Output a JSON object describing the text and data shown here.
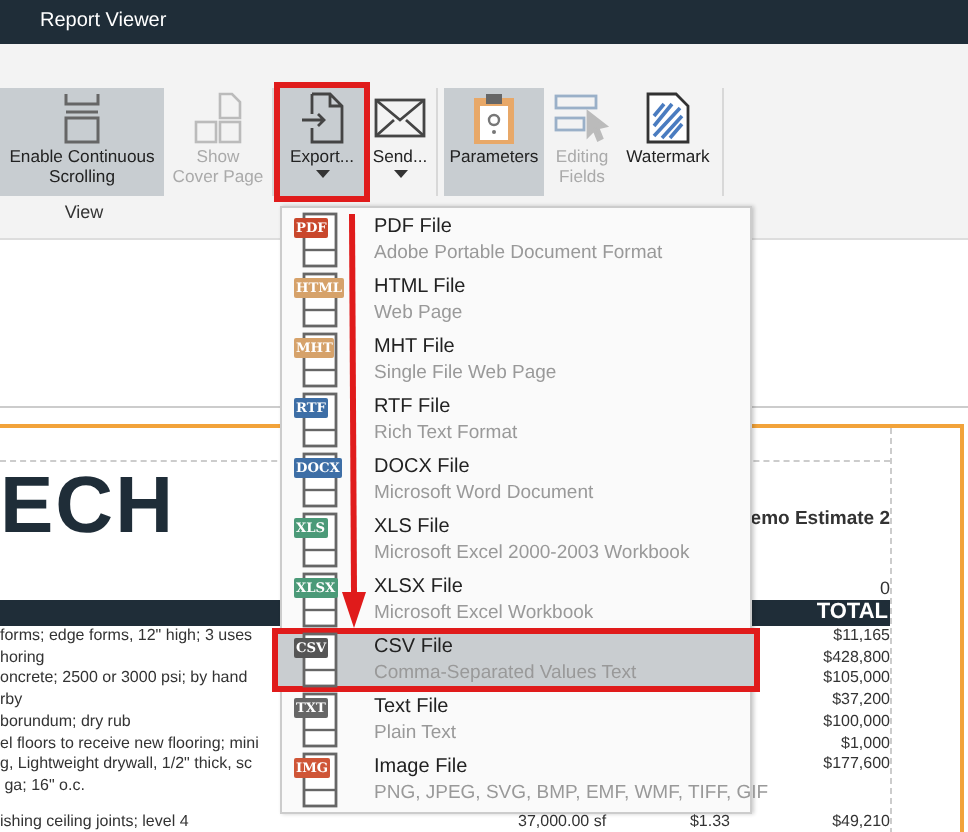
{
  "window": {
    "title": "Report Viewer"
  },
  "ribbon": {
    "buttons": [
      {
        "label": "Enable Continuous Scrolling",
        "selected": true,
        "disabled": false,
        "dropdown": false,
        "outlined": false
      },
      {
        "label": "Show Cover Page",
        "selected": false,
        "disabled": true,
        "dropdown": false,
        "outlined": false
      },
      {
        "label": "Export...",
        "selected": true,
        "disabled": false,
        "dropdown": true,
        "outlined": true
      },
      {
        "label": "Send...",
        "selected": false,
        "disabled": false,
        "dropdown": true,
        "outlined": false
      },
      {
        "label": "Parameters",
        "selected": true,
        "disabled": false,
        "dropdown": false,
        "outlined": false
      },
      {
        "label": "Editing Fields",
        "selected": false,
        "disabled": true,
        "dropdown": false,
        "outlined": false
      },
      {
        "label": "Watermark",
        "selected": false,
        "disabled": false,
        "dropdown": false,
        "outlined": false
      }
    ],
    "group_label": "View"
  },
  "export_menu": {
    "items": [
      {
        "badge": "PDF",
        "color": "#c9472c",
        "title": "PDF File",
        "description": "Adobe Portable Document Format",
        "selected": false,
        "outlined": false
      },
      {
        "badge": "HTML",
        "color": "#d6a26a",
        "title": "HTML File",
        "description": "Web Page",
        "selected": false,
        "outlined": false
      },
      {
        "badge": "MHT",
        "color": "#d6a26a",
        "title": "MHT File",
        "description": "Single File Web Page",
        "selected": false,
        "outlined": false
      },
      {
        "badge": "RTF",
        "color": "#3d6ea6",
        "title": "RTF File",
        "description": "Rich Text Format",
        "selected": false,
        "outlined": false
      },
      {
        "badge": "DOCX",
        "color": "#3d6ea6",
        "title": "DOCX File",
        "description": "Microsoft Word Document",
        "selected": false,
        "outlined": false
      },
      {
        "badge": "XLS",
        "color": "#4b9a78",
        "title": "XLS File",
        "description": "Microsoft Excel 2000-2003 Workbook",
        "selected": false,
        "outlined": false
      },
      {
        "badge": "XLSX",
        "color": "#4b9a78",
        "title": "XLSX File",
        "description": "Microsoft Excel Workbook",
        "selected": false,
        "outlined": false
      },
      {
        "badge": "CSV",
        "color": "#555555",
        "title": "CSV File",
        "description": "Comma-Separated Values Text",
        "selected": true,
        "outlined": true
      },
      {
        "badge": "TXT",
        "color": "#666666",
        "title": "Text File",
        "description": "Plain Text",
        "selected": false,
        "outlined": false
      },
      {
        "badge": "IMG",
        "color": "#cf5537",
        "title": "Image File",
        "description": "PNG, JPEG, SVG, BMP, EMF, WMF, TIFF, GIF",
        "selected": false,
        "outlined": false
      }
    ]
  },
  "report": {
    "logo": "ECH",
    "estimate_title": "emo Estimate 2",
    "header_value": "0",
    "total_header": "TOTAL",
    "rows": [
      {
        "description": "forms; edge forms, 12\" high; 3 uses",
        "total": "$11,165"
      },
      {
        "description": "horing",
        "total": "$428,800"
      },
      {
        "description": "oncrete; 2500 or 3000 psi; by hand",
        "total": "$105,000"
      },
      {
        "description": "rby",
        "total": "$37,200"
      },
      {
        "description": "borundum; dry rub",
        "total": "$100,000"
      },
      {
        "description": "el floors to receive new flooring; mini",
        "total": "$1,000"
      },
      {
        "description": "g, Lightweight drywall, 1/2\" thick, sc\n ga; 16\" o.c.",
        "total": "$177,600"
      },
      {
        "description": "ishing ceiling joints; level 4",
        "quantity": "37,000.00 sf",
        "unit_cost": "$1.33",
        "total": "$49,210"
      }
    ]
  }
}
